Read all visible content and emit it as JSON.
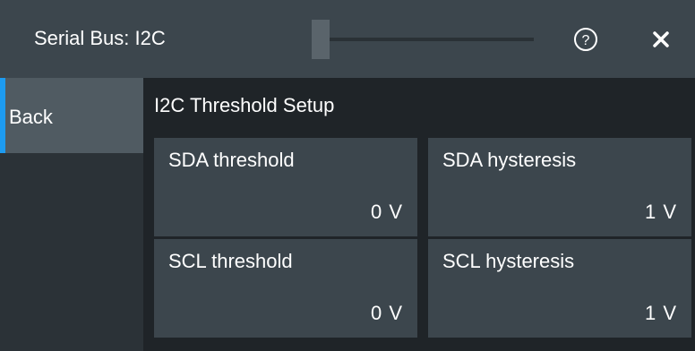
{
  "header": {
    "title": "Serial Bus: I2C",
    "slider_level": 0,
    "help_icon": "help-circle-icon",
    "close_icon": "close-x-icon"
  },
  "sidebar": {
    "back_label": "Back"
  },
  "main": {
    "section_title": "I2C Threshold Setup",
    "fields": [
      {
        "label": "SDA threshold",
        "value": "0 V"
      },
      {
        "label": "SDA hysteresis",
        "value": "1 V"
      },
      {
        "label": "SCL threshold",
        "value": "0 V"
      },
      {
        "label": "SCL hysteresis",
        "value": "1 V"
      }
    ]
  },
  "colors": {
    "titlebar": "#3c464d",
    "panel_bg": "#1f2428",
    "field_bg": "#3c464d",
    "back_button_bg": "#505b62",
    "accent": "#1d9bf0"
  }
}
